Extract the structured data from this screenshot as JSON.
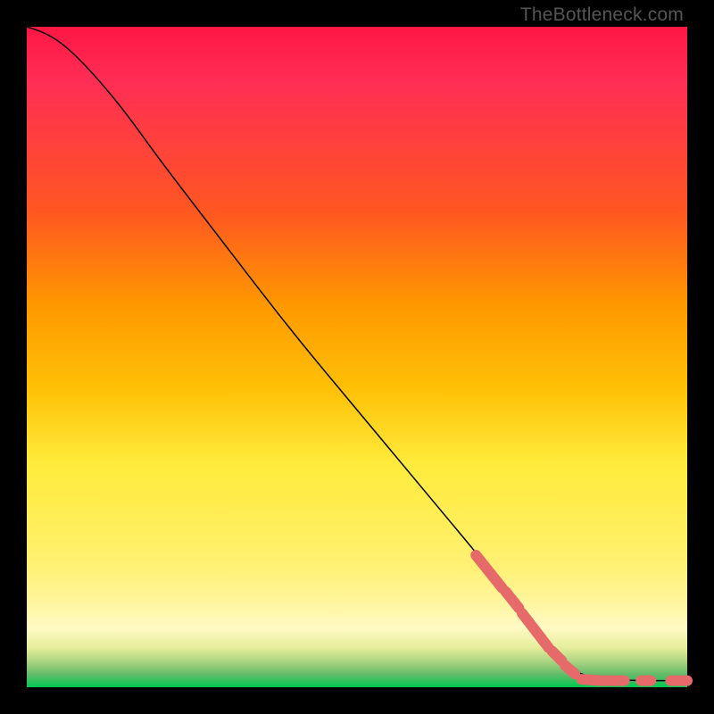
{
  "watermark": "TheBottleneck.com",
  "chart_data": {
    "type": "line",
    "title": "",
    "xlabel": "",
    "ylabel": "",
    "note": "Axes are not labeled. Values are fractional positions in a 0–1 coordinate box (x right, y up).",
    "line": {
      "name": "curve",
      "points": [
        {
          "x": 0.0,
          "y": 1.0
        },
        {
          "x": 0.03,
          "y": 0.99
        },
        {
          "x": 0.06,
          "y": 0.97
        },
        {
          "x": 0.1,
          "y": 0.93
        },
        {
          "x": 0.15,
          "y": 0.87
        },
        {
          "x": 0.2,
          "y": 0.8
        },
        {
          "x": 0.3,
          "y": 0.67
        },
        {
          "x": 0.4,
          "y": 0.54
        },
        {
          "x": 0.5,
          "y": 0.42
        },
        {
          "x": 0.6,
          "y": 0.3
        },
        {
          "x": 0.7,
          "y": 0.18
        },
        {
          "x": 0.78,
          "y": 0.08
        },
        {
          "x": 0.82,
          "y": 0.03
        },
        {
          "x": 0.85,
          "y": 0.015
        },
        {
          "x": 0.9,
          "y": 0.01
        },
        {
          "x": 1.0,
          "y": 0.01
        }
      ]
    },
    "markers": {
      "name": "highlighted-segments",
      "color": "#e66a6a",
      "segments": [
        {
          "x1": 0.68,
          "y1": 0.2,
          "x2": 0.72,
          "y2": 0.15
        },
        {
          "x1": 0.725,
          "y1": 0.145,
          "x2": 0.745,
          "y2": 0.12
        },
        {
          "x1": 0.75,
          "y1": 0.112,
          "x2": 0.79,
          "y2": 0.06
        },
        {
          "x1": 0.795,
          "y1": 0.055,
          "x2": 0.81,
          "y2": 0.04
        },
        {
          "x1": 0.815,
          "y1": 0.033,
          "x2": 0.83,
          "y2": 0.02
        },
        {
          "x1": 0.84,
          "y1": 0.012,
          "x2": 0.87,
          "y2": 0.01
        },
        {
          "x1": 0.875,
          "y1": 0.01,
          "x2": 0.905,
          "y2": 0.01
        },
        {
          "x1": 0.93,
          "y1": 0.01,
          "x2": 0.945,
          "y2": 0.01
        },
        {
          "x1": 0.975,
          "y1": 0.01,
          "x2": 0.985,
          "y2": 0.01
        },
        {
          "x1": 0.99,
          "y1": 0.01,
          "x2": 1.0,
          "y2": 0.01
        }
      ]
    }
  }
}
